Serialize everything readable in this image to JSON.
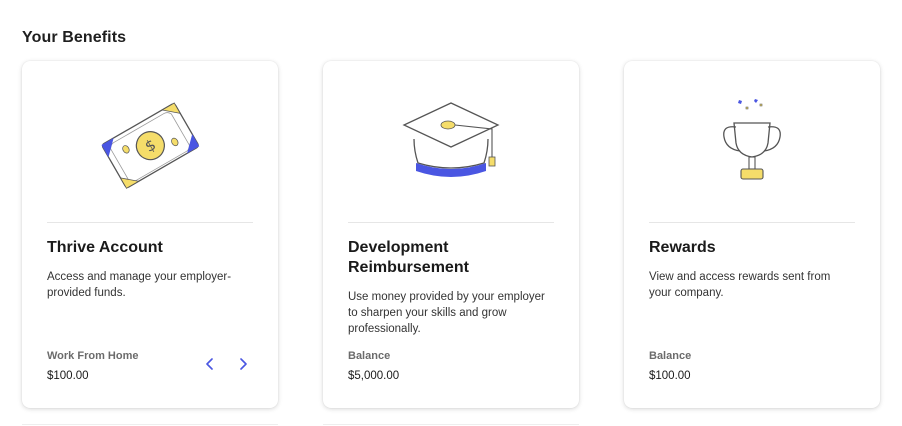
{
  "page": {
    "section_title": "Your Benefits"
  },
  "cards": [
    {
      "title": "Thrive Account",
      "description": "Access and manage your employer-provided funds.",
      "meta_label": "Work From Home",
      "meta_value": "$100.00",
      "illustration": "money-bill-icon",
      "has_carousel": true
    },
    {
      "title": "Development Reimbursement",
      "description": "Use money provided by your employer to sharpen your skills and grow professionally.",
      "meta_label": "Balance",
      "meta_value": "$5,000.00",
      "illustration": "graduation-cap-icon",
      "has_carousel": false
    },
    {
      "title": "Rewards",
      "description": "View and access rewards sent from your company.",
      "meta_label": "Balance",
      "meta_value": "$100.00",
      "illustration": "trophy-icon",
      "has_carousel": false
    }
  ],
  "colors": {
    "accent_blue": "#4a56e2",
    "accent_yellow": "#f5dd6a",
    "outline": "#555555"
  }
}
